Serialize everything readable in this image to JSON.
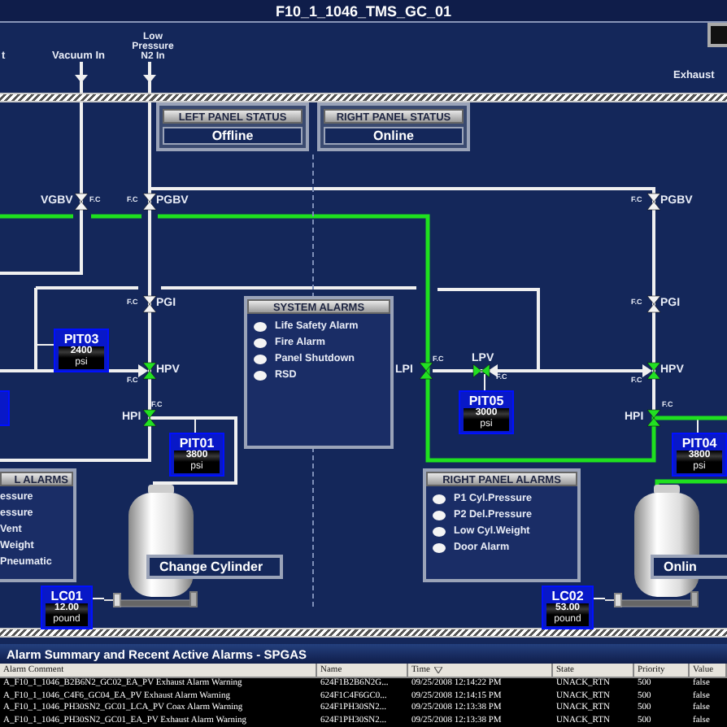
{
  "title": "F10_1_1046_TMS_GC_01",
  "inlets": [
    {
      "label": "t"
    },
    {
      "label": "Vacuum In"
    },
    {
      "label": "Low Pressure N2 In"
    },
    {
      "label": "Exhaust"
    }
  ],
  "panel_status": [
    {
      "title": "LEFT PANEL STATUS",
      "value": "Offline"
    },
    {
      "title": "RIGHT PANEL STATUS",
      "value": "Online"
    }
  ],
  "valves": [
    {
      "tag": "VGBV",
      "note": "F.C",
      "open": false
    },
    {
      "tag": "PGBV",
      "note": "F.C",
      "open": false
    },
    {
      "tag": "PGBV",
      "note": "F.C",
      "open": false
    },
    {
      "tag": "PGI",
      "note": "F.C",
      "open": false
    },
    {
      "tag": "PGI",
      "note": "F.C",
      "open": false
    },
    {
      "tag": "HPV",
      "note": "F.C",
      "open": true
    },
    {
      "tag": "HPV",
      "note": "F.C",
      "open": true
    },
    {
      "tag": "HPI",
      "note": "F.C",
      "open": true
    },
    {
      "tag": "HPI",
      "note": "F.C",
      "open": true
    },
    {
      "tag": "LPI",
      "note": "F.C",
      "open": true
    },
    {
      "tag": "LPV",
      "note": "F.C",
      "open": true
    }
  ],
  "transmitters": [
    {
      "tag": "PIT03",
      "value": "2400",
      "unit": "psi"
    },
    {
      "tag": "PIT01",
      "value": "3800",
      "unit": "psi"
    },
    {
      "tag": "PIT05",
      "value": "3000",
      "unit": "psi"
    },
    {
      "tag": "PIT04",
      "value": "3800",
      "unit": "psi"
    }
  ],
  "system_alarms": {
    "title": "SYSTEM ALARMS",
    "items": [
      {
        "label": "Life Safety Alarm",
        "active": false
      },
      {
        "label": "Fire Alarm",
        "active": false
      },
      {
        "label": "Panel Shutdown",
        "active": false
      },
      {
        "label": "RSD",
        "active": false
      }
    ]
  },
  "left_panel_alarms": {
    "title": "L ALARMS",
    "items": [
      {
        "label": "essure"
      },
      {
        "label": "essure"
      },
      {
        "label": "Vent"
      },
      {
        "label": "Weight"
      },
      {
        "label": "Pneumatic"
      }
    ]
  },
  "right_panel_alarms": {
    "title": "RIGHT PANEL ALARMS",
    "items": [
      {
        "label": "P1 Cyl.Pressure",
        "active": false
      },
      {
        "label": "P2 Del.Pressure",
        "active": false
      },
      {
        "label": "Low Cyl.Weight",
        "active": false
      },
      {
        "label": "Door Alarm",
        "active": false
      }
    ]
  },
  "buttons": [
    "Change Cylinder",
    "Onlin"
  ],
  "load_cells": [
    {
      "tag": "LC01",
      "value": "12.00",
      "unit": "pound"
    },
    {
      "tag": "LC02",
      "value": "53.00",
      "unit": "pound"
    }
  ],
  "alarm_summary": {
    "title": "Alarm Summary and Recent Active Alarms - SPGAS",
    "columns": [
      "Alarm Comment",
      "Name",
      "Time",
      "State",
      "Priority",
      "Value"
    ],
    "rows": [
      [
        "A_F10_1_1046_B2B6N2_GC02_EA_PV  Exhaust Alarm Warning",
        "624F1B2B6N2G...",
        "09/25/2008 12:14:22 PM",
        "UNACK_RTN",
        "500",
        "false"
      ],
      [
        "A_F10_1_1046_C4F6_GC04_EA_PV  Exhaust Alarm Warning",
        "624F1C4F6GC0...",
        "09/25/2008 12:14:15 PM",
        "UNACK_RTN",
        "500",
        "false"
      ],
      [
        "A_F10_1_1046_PH30SN2_GC01_LCA_PV  Coax Alarm Warning",
        "624F1PH30SN2...",
        "09/25/2008 12:13:38 PM",
        "UNACK_RTN",
        "500",
        "false"
      ],
      [
        "A_F10_1_1046_PH30SN2_GC01_EA_PV  Exhaust Alarm Warning",
        "624F1PH30SN2...",
        "09/25/2008 12:13:38 PM",
        "UNACK_RTN",
        "500",
        "false"
      ]
    ]
  }
}
